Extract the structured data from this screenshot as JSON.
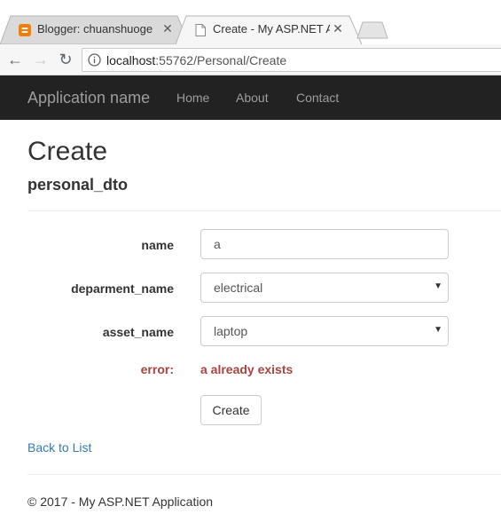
{
  "browser": {
    "tabs": [
      {
        "title": "Blogger: chuanshuoge - E",
        "close": "✕"
      },
      {
        "title": "Create - My ASP.NET App",
        "close": "✕"
      }
    ],
    "address": {
      "host": "localhost",
      "rest": ":55762/Personal/Create"
    },
    "icons": {
      "back": "←",
      "forward": "→",
      "reload": "↻",
      "blogger_favicon_color": "#f57d00"
    }
  },
  "navbar": {
    "brand": "Application name",
    "links": [
      "Home",
      "About",
      "Contact"
    ]
  },
  "page": {
    "title": "Create",
    "subtitle": "personal_dto"
  },
  "form": {
    "name": {
      "label": "name",
      "value": "a"
    },
    "department": {
      "label": "deparment_name",
      "value": "electrical"
    },
    "asset": {
      "label": "asset_name",
      "value": "laptop"
    },
    "error": {
      "label": "error:",
      "message": "a already exists"
    },
    "submit_label": "Create"
  },
  "back_link": "Back to List",
  "footer": "© 2017 - My ASP.NET Application",
  "colors": {
    "navbar_bg": "#222222",
    "link": "#337ab7",
    "error": "#a94442"
  }
}
